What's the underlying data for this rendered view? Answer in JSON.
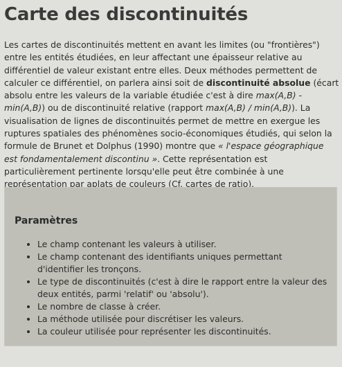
{
  "page": {
    "title": "Carte des discontinuités"
  },
  "intro": {
    "p1": "Les cartes de discontinuités mettent en avant les limites (ou \"frontières\") entre les entités étudiées, en leur affectant une épaisseur relative au différentiel de valeur existant entre elles. Deux méthodes permettent de calculer ce différentiel, on parlera ainsi soit de ",
    "bold1": "discontinuité absolue",
    "p2": " (écart absolu entre les valeurs de la variable étudiée c'est à dire ",
    "italic1": "max(A,B) - min(A,B)",
    "p3": ") ou de discontinuité relative (rapport ",
    "italic2": "max(A,B) / min(A,B)",
    "p4": "). La visualisation de lignes de discontinuités permet de mettre en exergue les ruptures spatiales des phénomènes socio-économiques étudiés, qui selon la formule de Brunet et Dolphus (1990) montre que ",
    "italic3": "« l'espace géographique est fondamentalement discontinu »",
    "p5": ". Cette représentation est particulièrement pertinente lorsqu'elle peut être combinée à une représentation par aplats de couleurs (Cf. cartes de ratio)."
  },
  "params": {
    "title": "Paramètres",
    "items": [
      "Le champ contenant les valeurs à utiliser.",
      "Le champ contenant des identifiants uniques permettant d'identifier les tronçons.",
      "Le type de discontinuités (c'est à dire le rapport entre la valeur des deux entités, parmi 'relatif' ou 'absolu').",
      "Le nombre de classe à créer.",
      "La méthode utilisée pour discrétiser les valeurs.",
      "La couleur utilisée pour représenter les discontinuités."
    ]
  }
}
